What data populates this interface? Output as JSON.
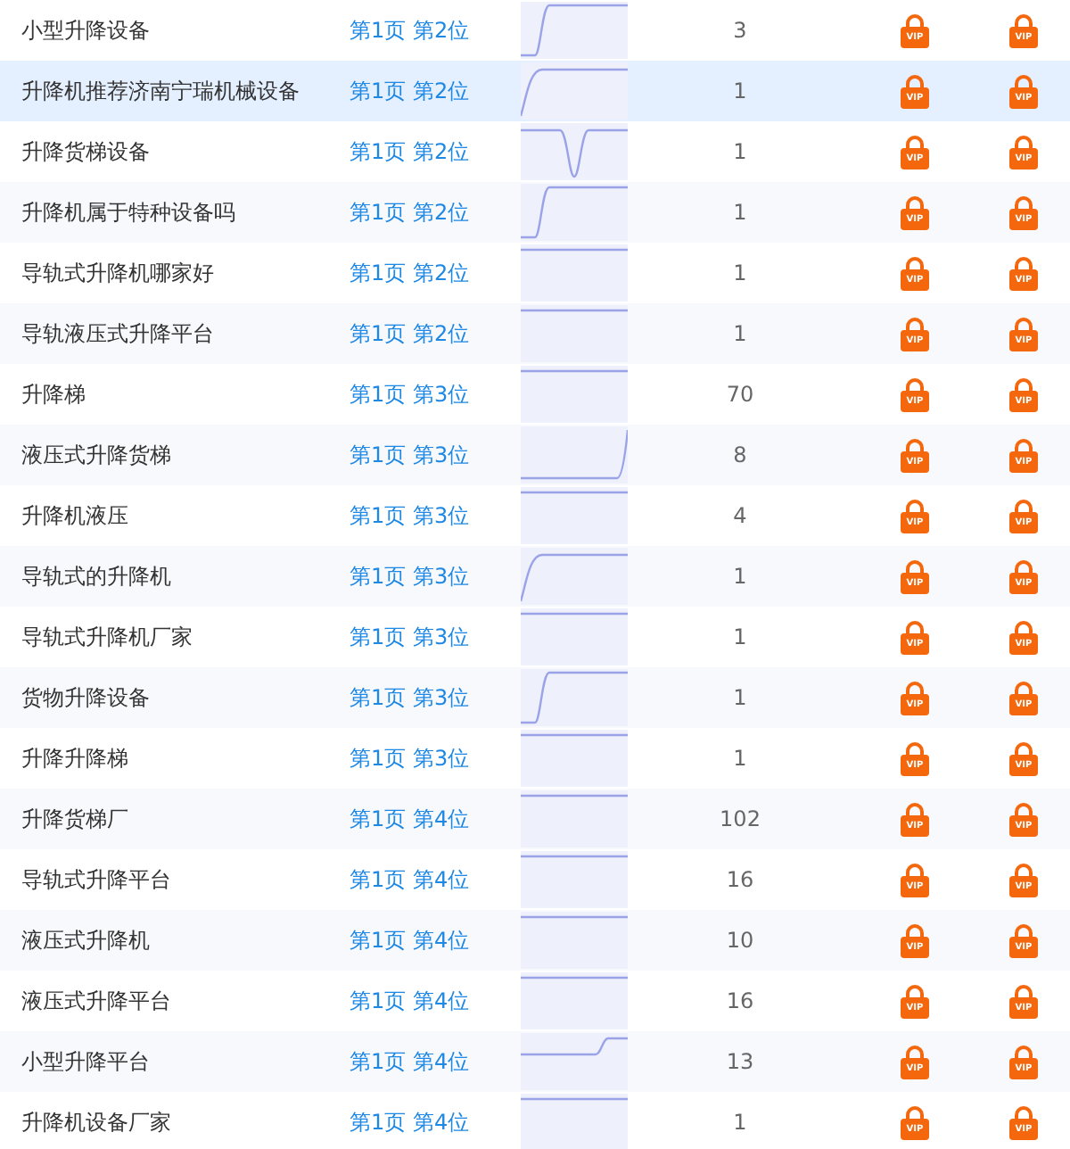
{
  "rows": [
    {
      "keyword": "小型升降设备",
      "rank": "第1页 第2位",
      "sparkline": {
        "kind": "rise"
      },
      "count": "3",
      "locks": [
        "VIP",
        "VIP"
      ],
      "selected": false
    },
    {
      "keyword": "升降机推荐济南宁瑞机械设备",
      "rank": "第1页 第2位",
      "sparkline": {
        "kind": "start"
      },
      "count": "1",
      "locks": [
        "VIP",
        "VIP"
      ],
      "selected": true
    },
    {
      "keyword": "升降货梯设备",
      "rank": "第1页 第2位",
      "sparkline": {
        "kind": "dip"
      },
      "count": "1",
      "locks": [
        "VIP",
        "VIP"
      ],
      "selected": false
    },
    {
      "keyword": "升降机属于特种设备吗",
      "rank": "第1页 第2位",
      "sparkline": {
        "kind": "rise"
      },
      "count": "1",
      "locks": [
        "VIP",
        "VIP"
      ],
      "selected": false
    },
    {
      "keyword": "导轨式升降机哪家好",
      "rank": "第1页 第2位",
      "sparkline": {
        "kind": "flat"
      },
      "count": "1",
      "locks": [
        "VIP",
        "VIP"
      ],
      "selected": false
    },
    {
      "keyword": "导轨液压式升降平台",
      "rank": "第1页 第2位",
      "sparkline": {
        "kind": "flat"
      },
      "count": "1",
      "locks": [
        "VIP",
        "VIP"
      ],
      "selected": false
    },
    {
      "keyword": "升降梯",
      "rank": "第1页 第3位",
      "sparkline": {
        "kind": "flat"
      },
      "count": "70",
      "locks": [
        "VIP",
        "VIP"
      ],
      "selected": false
    },
    {
      "keyword": "液压式升降货梯",
      "rank": "第1页 第3位",
      "sparkline": {
        "kind": "late"
      },
      "count": "8",
      "locks": [
        "VIP",
        "VIP"
      ],
      "selected": false
    },
    {
      "keyword": "升降机液压",
      "rank": "第1页 第3位",
      "sparkline": {
        "kind": "flat"
      },
      "count": "4",
      "locks": [
        "VIP",
        "VIP"
      ],
      "selected": false
    },
    {
      "keyword": "导轨式的升降机",
      "rank": "第1页 第3位",
      "sparkline": {
        "kind": "start"
      },
      "count": "1",
      "locks": [
        "VIP",
        "VIP"
      ],
      "selected": false
    },
    {
      "keyword": "导轨式升降机厂家",
      "rank": "第1页 第3位",
      "sparkline": {
        "kind": "flat"
      },
      "count": "1",
      "locks": [
        "VIP",
        "VIP"
      ],
      "selected": false
    },
    {
      "keyword": "货物升降设备",
      "rank": "第1页 第3位",
      "sparkline": {
        "kind": "rise"
      },
      "count": "1",
      "locks": [
        "VIP",
        "VIP"
      ],
      "selected": false
    },
    {
      "keyword": "升降升降梯",
      "rank": "第1页 第3位",
      "sparkline": {
        "kind": "flat"
      },
      "count": "1",
      "locks": [
        "VIP",
        "VIP"
      ],
      "selected": false
    },
    {
      "keyword": "升降货梯厂",
      "rank": "第1页 第4位",
      "sparkline": {
        "kind": "flat"
      },
      "count": "102",
      "locks": [
        "VIP",
        "VIP"
      ],
      "selected": false
    },
    {
      "keyword": "导轨式升降平台",
      "rank": "第1页 第4位",
      "sparkline": {
        "kind": "flat"
      },
      "count": "16",
      "locks": [
        "VIP",
        "VIP"
      ],
      "selected": false
    },
    {
      "keyword": "液压式升降机",
      "rank": "第1页 第4位",
      "sparkline": {
        "kind": "flat"
      },
      "count": "10",
      "locks": [
        "VIP",
        "VIP"
      ],
      "selected": false
    },
    {
      "keyword": "液压式升降平台",
      "rank": "第1页 第4位",
      "sparkline": {
        "kind": "flat"
      },
      "count": "16",
      "locks": [
        "VIP",
        "VIP"
      ],
      "selected": false
    },
    {
      "keyword": "小型升降平台",
      "rank": "第1页 第4位",
      "sparkline": {
        "kind": "mid"
      },
      "count": "13",
      "locks": [
        "VIP",
        "VIP"
      ],
      "selected": false
    },
    {
      "keyword": "升降机设备厂家",
      "rank": "第1页 第4位",
      "sparkline": {
        "kind": "flat"
      },
      "count": "1",
      "locks": [
        "VIP",
        "VIP"
      ],
      "selected": false
    }
  ]
}
